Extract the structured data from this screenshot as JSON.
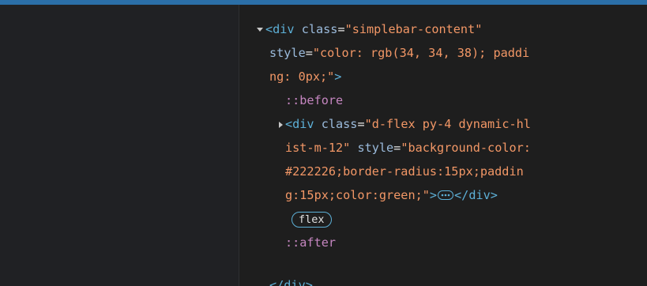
{
  "devtools": {
    "lines": [
      {
        "text": "<div class=\"simplebar-content\""
      },
      {
        "text": "style=\"color: rgb(34, 34, 38); paddi"
      },
      {
        "text": "ng: 0px;\">"
      },
      {
        "text": "::before"
      },
      {
        "text": "<div class=\"d-flex py-4 dynamic-hl"
      },
      {
        "text": "ist-m-12\" style=\"background-color:"
      },
      {
        "text": "#222226;border-radius:15px;paddin"
      },
      {
        "text": "g:15px;color:green;\">"
      },
      {
        "text": "flex"
      },
      {
        "text": "::after"
      },
      {
        "text": "</div>"
      }
    ],
    "badges": {
      "flex": "flex",
      "ellipsis_icon": "ellipsis-icon"
    },
    "colors": {
      "tag": "#5db0d7",
      "attr": "#9bbbdc",
      "value": "#f29766",
      "pseudo": "#c586c0",
      "accent": "#2b6fa8"
    }
  }
}
